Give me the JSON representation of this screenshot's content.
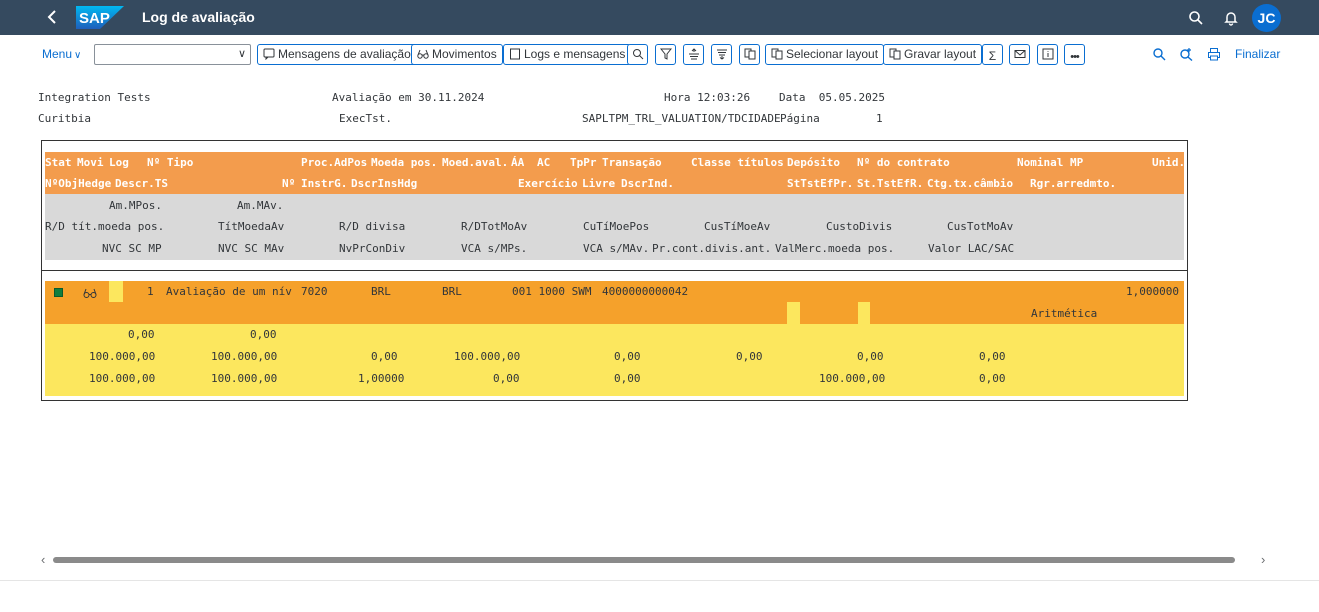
{
  "shell": {
    "title": "Log de avaliação",
    "avatar_initials": "JC",
    "brand_color": "#354a5f"
  },
  "toolbar": {
    "menu_label": "Menu",
    "select_value": "",
    "buttons": {
      "mensagens": "Mensagens de avaliação",
      "movimentos": "Movimentos",
      "logs": "Logs e mensagens",
      "selecionar_layout": "Selecionar layout",
      "gravar_layout": "Gravar layout"
    },
    "finalizar": "Finalizar"
  },
  "report_header": {
    "line1": {
      "company": "Integration Tests",
      "valuation": "Avaliação em 30.11.2024",
      "time": "Hora 12:03:26",
      "date": "Data  05.05.2025"
    },
    "line2": {
      "city": "Curitbia",
      "exec": "ExecTst.",
      "program": "SAPLTPM_TRL_VALUATION/TDCIDADE",
      "page_label": "Página",
      "page_no": "1"
    }
  },
  "list_header": {
    "row1": [
      "Stat",
      "Movi",
      "Log",
      "Nº Tipo",
      "Proc.AdPos",
      "Moeda pos.",
      "Moed.aval.",
      "ÁA",
      "AC",
      "TpPr",
      "Transação",
      "Classe títulos",
      "Depósito",
      "Nº do contrato",
      "Nominal MP",
      "Unid."
    ],
    "row2": [
      "NºObjHedge",
      "Descr.TS",
      "Nº",
      "InstrG.",
      "DscrInsHdg",
      "Exercício",
      "Livre",
      "DscrInd.",
      "StTstEfPr.",
      "St.TstEfR.",
      "Ctg.tx.câmbio",
      "Rgr.arredmto."
    ],
    "row3": [
      "Am.MPos.",
      "Am.MAv."
    ],
    "row4": [
      "R/D tít.moeda pos.",
      "TítMoedaAv",
      "R/D divisa",
      "R/DTotMoAv",
      "CuTíMoePos",
      "CusTíMoeAv",
      "CustoDivis",
      "CusTotMoAv"
    ],
    "row5": [
      "NVC SC MP",
      "NVC SC MAv",
      "NvPrConDiv",
      "VCA s/MPs.",
      "VCA s/MAv.",
      "Pr.cont.divis.ant.",
      "ValMerc.moeda pos.",
      "Valor LAC/SAC"
    ]
  },
  "list_row": {
    "line1": {
      "number": "1",
      "tipo_descr": "Avaliação de um nív",
      "code": "7020",
      "moeda_pos": "BRL",
      "moeda_aval": "BRL",
      "transacao": "001 1000 SWM",
      "contract": "4000000000042",
      "nominal": "1,000000"
    },
    "line2": {
      "regra": "Aritmética"
    },
    "line3": [
      "0,00",
      "0,00"
    ],
    "line4": [
      "100.000,00",
      "100.000,00",
      "0,00",
      "100.000,00",
      "0,00",
      "0,00",
      "0,00",
      "0,00"
    ],
    "line5": [
      "100.000,00",
      "100.000,00",
      "1,00000",
      "0,00",
      "0,00",
      "100.000,00",
      "0,00"
    ]
  }
}
